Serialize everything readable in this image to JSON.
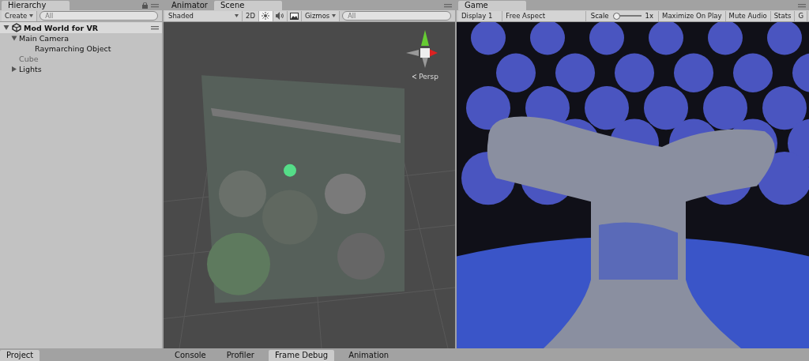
{
  "hierarchy": {
    "tab": "Hierarchy",
    "create": "Create",
    "search_placeholder": "All",
    "scene_name": "Mod World for VR",
    "items": [
      {
        "label": "Main Camera",
        "active": true,
        "expanded": true,
        "children": [
          {
            "label": "Raymarching Object",
            "active": true
          }
        ]
      },
      {
        "label": "Cube",
        "active": false
      },
      {
        "label": "Lights",
        "active": true,
        "expanded": false
      }
    ]
  },
  "scene": {
    "tabs": [
      {
        "label": "Animator",
        "selected": false
      },
      {
        "label": "Scene",
        "selected": true
      }
    ],
    "shading": "Shaded",
    "mode_2d": "2D",
    "toggles": [
      {
        "kind": "lighting",
        "on": true
      },
      {
        "kind": "audio",
        "on": false
      },
      {
        "kind": "effects",
        "on": false
      }
    ],
    "gizmos": "Gizmos",
    "search_placeholder": "All",
    "projection": "Persp"
  },
  "game": {
    "tab": "Game",
    "display": "Display 1",
    "aspect": "Free Aspect",
    "scale_label": "Scale",
    "scale": {
      "level": 0
    },
    "scale_value": "1x",
    "buttons": [
      {
        "label": "Maximize On Play",
        "on": false
      },
      {
        "label": "Mute Audio",
        "on": false
      },
      {
        "label": "Stats",
        "on": false
      },
      {
        "label": "G",
        "on": false
      }
    ]
  },
  "bottom": {
    "left_tab": "Project",
    "tabs": [
      {
        "label": "Console",
        "selected": false
      },
      {
        "label": "Profiler",
        "selected": false
      },
      {
        "label": "Frame Debug",
        "selected": true
      },
      {
        "label": "Animation",
        "selected": false
      }
    ]
  }
}
